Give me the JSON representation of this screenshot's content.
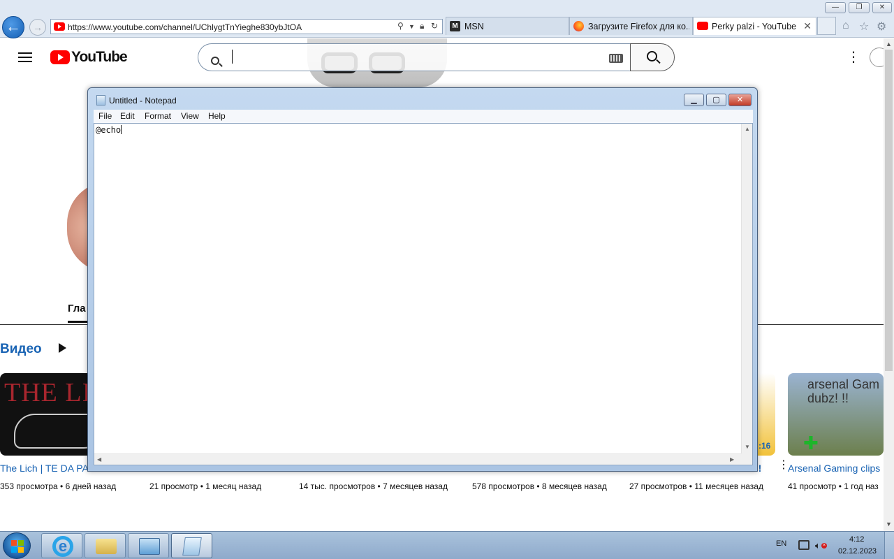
{
  "browser": {
    "url": "https://www.youtube.com/channel/UChlygtTnYieghe830ybJtOA",
    "tabs": [
      {
        "label": "MSN"
      },
      {
        "label": "Загрузите Firefox для ко..."
      },
      {
        "label": "Perky palzi - YouTube"
      }
    ],
    "controls": {
      "minimize": "—",
      "maximize": "❐",
      "close": "✕",
      "tab_close": "✕"
    }
  },
  "youtube": {
    "logo_text": "YouTube",
    "search_placeholder": "",
    "more_icon": "⋮",
    "channel_tab_fragment": "Гла",
    "videos_heading": "Видео",
    "videos": [
      {
        "title": "The Lich | TE DA PA",
        "meta": "353 просмотра • 6 дней назад"
      },
      {
        "title": "",
        "meta": "21 просмотр • 1 месяц назад"
      },
      {
        "title": "",
        "meta": "14 тыс. просмотров • 7 месяцев назад"
      },
      {
        "title": "",
        "meta": "578 просмотров • 8 месяцев назад"
      },
      {
        "title": "",
        "meta": "27 просмотров • 11 месяцев назад"
      },
      {
        "title": "Arsenal Gaming clips",
        "meta": "41 просмотр • 1 год наз"
      }
    ],
    "thumb1_text": "THE LI",
    "thumb5_fragment": ":16",
    "thumb5_title_fragment": "!!",
    "thumb6_text": "arsenal Gam dubz! !!",
    "thumb6_plus": "✚"
  },
  "notepad": {
    "title": "Untitled - Notepad",
    "menu": [
      "File",
      "Edit",
      "Format",
      "View",
      "Help"
    ],
    "content": "@echo",
    "controls": {
      "minimize": "▁",
      "maximize": "▢",
      "close": "✕"
    }
  },
  "taskbar": {
    "language": "EN",
    "time": "4:12",
    "date": "02.12.2023",
    "ie_glyph": "e"
  },
  "colors": {
    "yt_red": "#ff0000",
    "link_blue": "#1a64b4",
    "taskbar": "#8faacb"
  },
  "icons": [
    "back-arrow-icon",
    "forward-arrow-icon",
    "search-icon",
    "lock-icon",
    "refresh-icon",
    "home-icon",
    "star-icon",
    "gear-icon",
    "keyboard-icon",
    "play-icon",
    "windows-flag-icon",
    "network-icon",
    "speaker-muted-icon"
  ]
}
